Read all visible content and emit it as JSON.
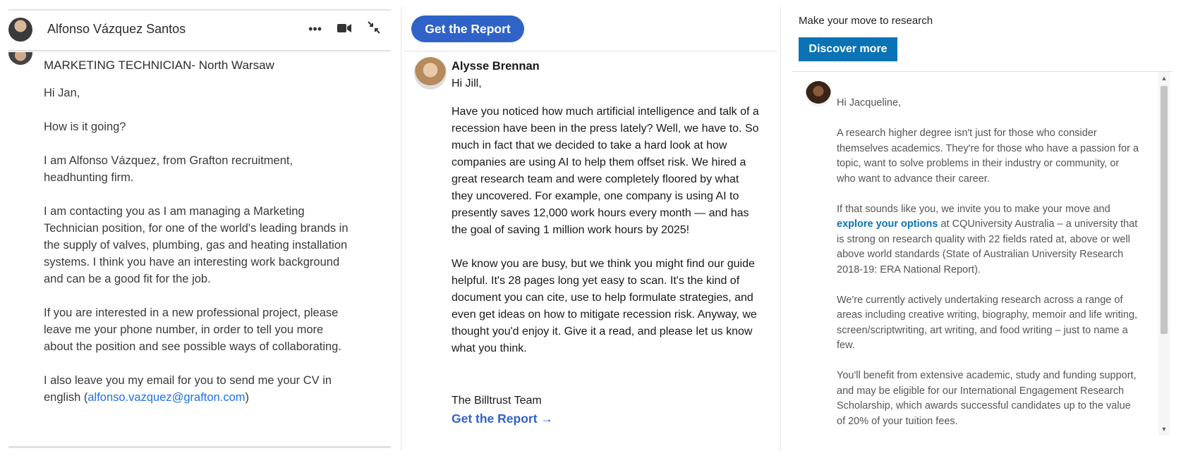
{
  "panel1": {
    "sender_name": "Alfonso Vázquez Santos",
    "icons": {
      "more": "more-icon",
      "video": "video-icon",
      "collapse": "collapse-icon"
    },
    "subject": "MARKETING TECHNICIAN- North Warsaw",
    "greeting": "Hi Jan,",
    "p1": "How is it going?",
    "p2": "I am Alfonso Vázquez, from Grafton recruitment, headhunting firm.",
    "p3": "I am contacting you as I am managing a Marketing Technician position, for one of the world's leading brands in the supply of valves, plumbing, gas and heating installation systems. I think you have an interesting work background and can be a good fit for the job.",
    "p4": "If you are interested in a new professional project, please leave me your phone number, in order to tell you more about the position and see possible ways of collaborating.",
    "p5_prefix": "I also leave you my email for you to send me your CV in english (",
    "email": "alfonso.vazquez@grafton.com",
    "p5_suffix": ")"
  },
  "panel2": {
    "cta_label": "Get the Report",
    "sender_name": "Alysse Brennan",
    "greeting": "Hi Jill,",
    "p1": "Have you noticed how much artificial intelligence and talk of a recession have been in the press lately? Well, we have to. So much in fact that we decided to take a hard look at how companies are using AI to help them offset risk. We hired a great research team and were completely floored by what they uncovered. For example, one company is using AI to presently saves 12,000 work hours every month — and has the goal of saving 1 million work hours by 2025!",
    "p2": "We know you are busy, but we think you might find our guide helpful. It's 28 pages long yet easy to scan. It's the kind of document you can cite, use to help formulate strategies, and even get ideas on how to mitigate recession risk. Anyway, we thought you'd enjoy it. Give it a read, and please let us know what you think.",
    "signature": "The Billtrust Team",
    "link_label": "Get the Report →"
  },
  "panel3": {
    "promo_text": "Make your move to research",
    "button_label": "Discover more",
    "greeting": "Hi Jacqueline,",
    "p1": "A research higher degree isn't just for those who consider themselves academics. They're for those who have a passion for a topic, want to solve problems in their industry or community, or who want to advance their career.",
    "p2_prefix": "If that sounds like you, we invite you to make your move and ",
    "p2_link": "explore your options",
    "p2_suffix": " at CQUniversity Australia – a university that is strong on research quality with 22 fields rated at, above or well above world standards (State of Australian University Research 2018-19: ERA National Report).",
    "p3": "We're currently actively undertaking research across a range of areas including creative writing, biography, memoir and life writing, screen/scriptwriting, art writing, and food writing – just to name a few.",
    "p4": "You'll benefit from extensive academic, study and funding support, and may be eligible for our International Engagement Research Scholarship, which awards successful candidates up to the value of 20% of your tuition fees."
  },
  "colors": {
    "linkedin_blue": "#2f63c8",
    "discover_blue": "#0b73b5",
    "email_link": "#1a73e8"
  }
}
